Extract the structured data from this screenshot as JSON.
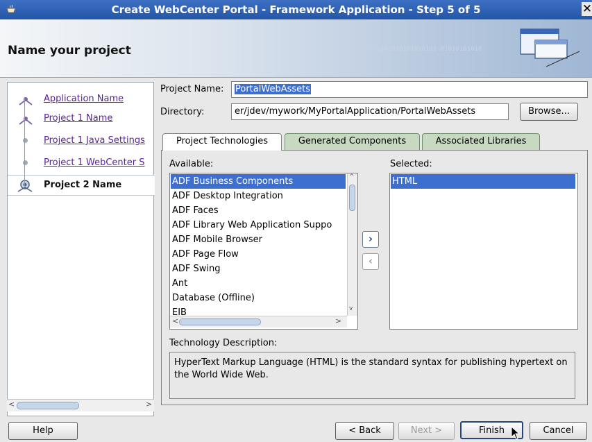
{
  "window": {
    "title": "Create WebCenter Portal - Framework Application - Step 5 of 5"
  },
  "header": {
    "title": "Name your project",
    "bits": "0101010101010101010101\n01010101010"
  },
  "nav": {
    "items": [
      {
        "label": "Application Name"
      },
      {
        "label": "Project 1 Name"
      },
      {
        "label": "Project 1 Java Settings"
      },
      {
        "label": "Project 1 WebCenter S"
      },
      {
        "label": "Project 2 Name"
      }
    ]
  },
  "form": {
    "project_name_label": "Project Name:",
    "project_name_value": "PortalWebAssets",
    "directory_label": "Directory:",
    "directory_value": "er/jdev/mywork/MyPortalApplication/PortalWebAssets",
    "browse_label": "Browse..."
  },
  "tabs": [
    "Project Technologies",
    "Generated Components",
    "Associated Libraries"
  ],
  "available": {
    "label": "Available:",
    "items": [
      "ADF Business Components",
      "ADF Desktop Integration",
      "ADF Faces",
      "ADF Library Web Application Suppo",
      "ADF Mobile Browser",
      "ADF Page Flow",
      "ADF Swing",
      "Ant",
      "Database (Offline)",
      "EJB"
    ]
  },
  "selected": {
    "label": "Selected:",
    "items": [
      "HTML"
    ]
  },
  "description": {
    "label": "Technology Description:",
    "text": "HyperText Markup Language (HTML) is the standard syntax for publishing hypertext on the World Wide Web."
  },
  "footer": {
    "help": "Help",
    "back": "< Back",
    "next": "Next >",
    "finish": "Finish",
    "cancel": "Cancel"
  }
}
